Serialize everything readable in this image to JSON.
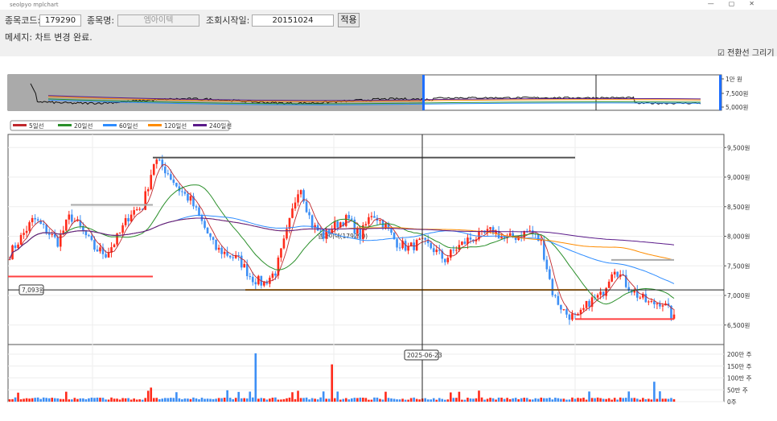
{
  "window": {
    "title": "seolpyo mplchart",
    "controls": [
      "—",
      "▢",
      "✕"
    ]
  },
  "toolbar": {
    "code_label": "종목코드:",
    "code_value": "179290",
    "name_label": "종목명:",
    "name_value": "엠아이텍",
    "date_label": "조회시작일:",
    "date_value": "20151024",
    "apply_label": "적용"
  },
  "message": "메세지: 차트 변경 완료.",
  "checkbox": {
    "label": "전환선 그리기",
    "checked": true
  },
  "legend": [
    {
      "label": "5일선",
      "color": "#c0282d"
    },
    {
      "label": "20일선",
      "color": "#2a8f2a"
    },
    {
      "label": "60일선",
      "color": "#2d8cff"
    },
    {
      "label": "120일선",
      "color": "#ff8c00"
    },
    {
      "label": "240일선",
      "color": "#5a1a8a"
    }
  ],
  "overview_axis": [
    "1만 원",
    "7,500원",
    "5,000원"
  ],
  "chart_data": {
    "type": "candlestick",
    "price_ticks": [
      {
        "v": 9500,
        "label": "9,500원"
      },
      {
        "v": 9000,
        "label": "9,000원"
      },
      {
        "v": 8500,
        "label": "8,500원"
      },
      {
        "v": 8000,
        "label": "8,000원"
      },
      {
        "v": 7500,
        "label": "7,500원"
      },
      {
        "v": 7000,
        "label": "7,000원"
      },
      {
        "v": 6500,
        "label": "6,500원"
      }
    ],
    "volume_ticks": [
      {
        "v": 200,
        "label": "200만 주"
      },
      {
        "v": 150,
        "label": "150만 주"
      },
      {
        "v": 100,
        "label": "100만 주"
      },
      {
        "v": 50,
        "label": "50만 주"
      },
      {
        "v": 0,
        "label": "0주"
      }
    ],
    "approx_closes": [
      7700,
      8000,
      8300,
      8100,
      7900,
      8350,
      8100,
      7800,
      7700,
      8000,
      8400,
      8500,
      9300,
      9100,
      8800,
      8600,
      8200,
      7800,
      7700,
      7600,
      7300,
      7200,
      7400,
      8100,
      8900,
      8200,
      8000,
      8200,
      8300,
      8000,
      8400,
      8200,
      7900,
      7800,
      7900,
      7800,
      7600,
      7800,
      7950,
      8000,
      8100,
      7950,
      8000,
      8100,
      7900,
      7000,
      6700,
      6600,
      6900,
      7000,
      7500,
      7200,
      7000,
      6850,
      6900,
      6600
    ],
    "up_color": "#ff2a1a",
    "down_color": "#3d8ff5",
    "crosshair": {
      "price_label": "7,093원",
      "date_label": "2025-06-23"
    },
    "watermark": "엠아이텍(179290)",
    "levels": [
      9330,
      8530,
      7320,
      7093,
      7600,
      6600
    ]
  }
}
